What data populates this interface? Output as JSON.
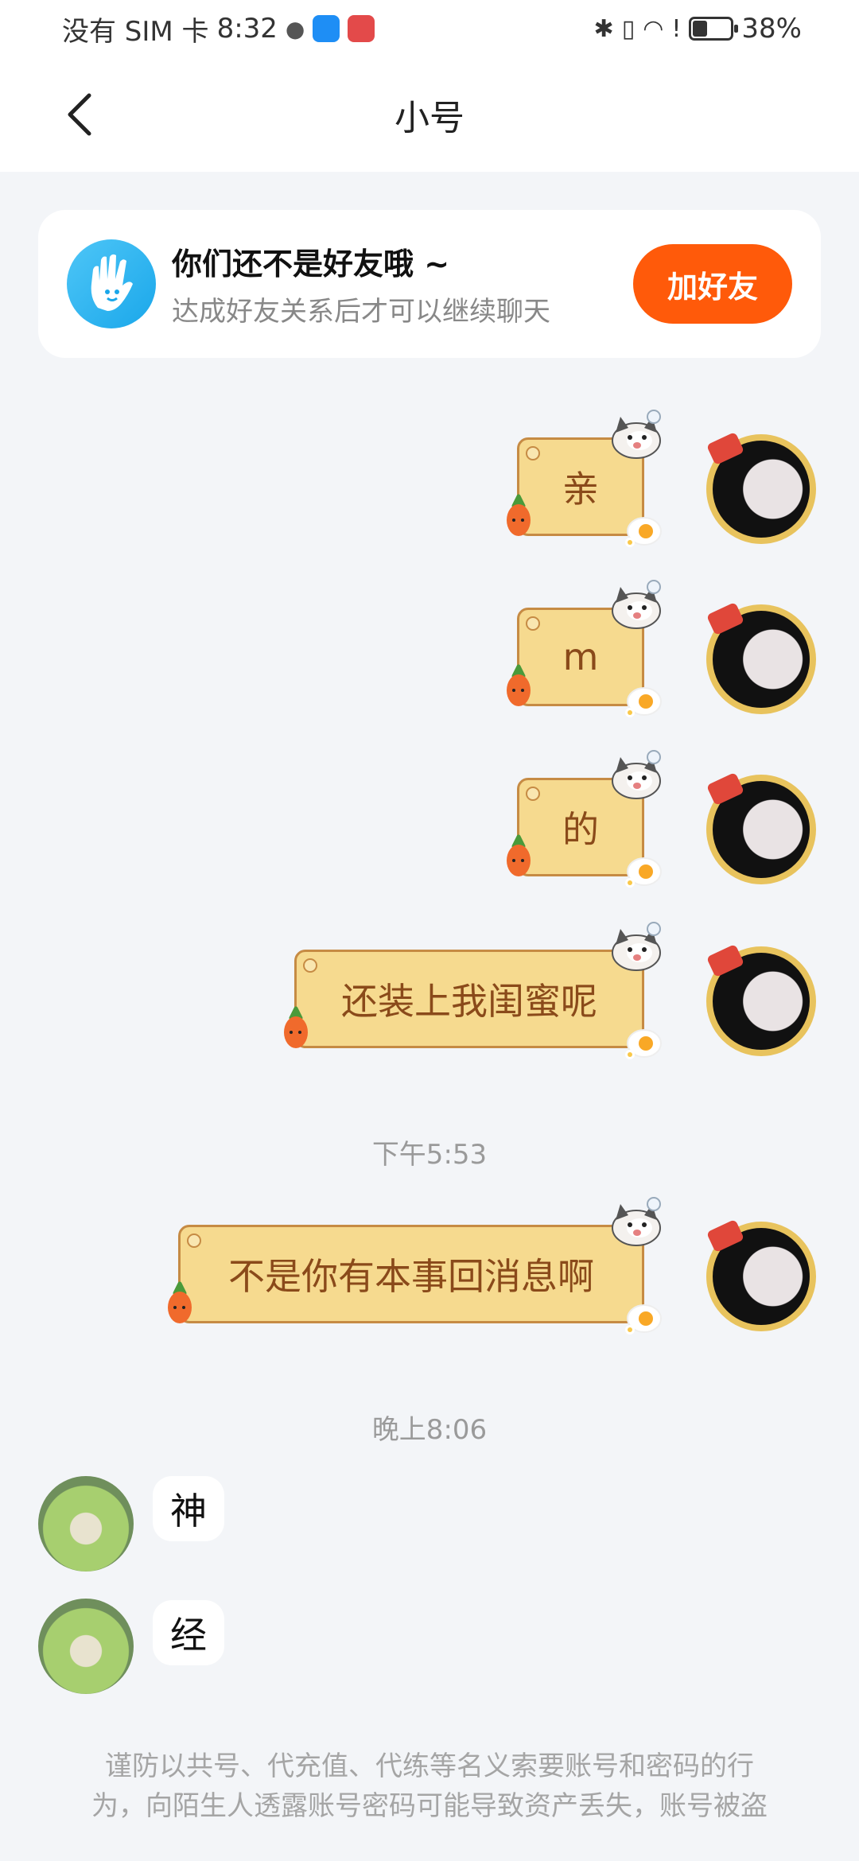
{
  "status_bar": {
    "carrier": "没有 SIM 卡",
    "time": "8:32",
    "battery": "38%",
    "battery_level": 0.38
  },
  "header": {
    "title": "小号"
  },
  "notice": {
    "title": "你们还不是好友哦 ~",
    "subtitle": "达成好友关系后才可以继续聊天",
    "add_button": "加好友"
  },
  "messages_out_1": [
    "亲",
    "m",
    "的",
    "还装上我闺蜜呢"
  ],
  "time_1": "下午5:53",
  "messages_out_2": [
    "不是你有本事回消息啊"
  ],
  "time_2": "晚上8:06",
  "messages_in": [
    "神",
    "经"
  ],
  "footer": {
    "line1": "谨防以共号、代充值、代练等名义索要账号和密码的行",
    "line2": "为，向陌生人透露账号密码可能导致资产丢失，账号被盗"
  }
}
